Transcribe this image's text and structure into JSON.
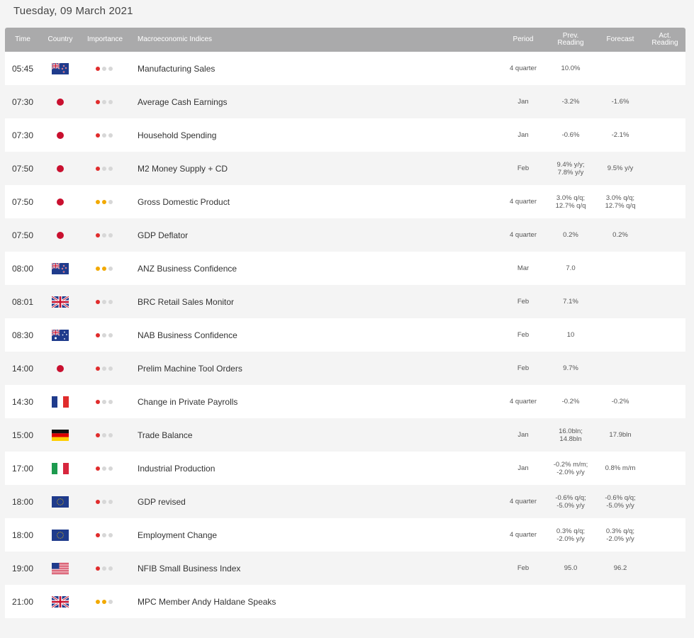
{
  "date": "Tuesday, 09 March 2021",
  "headers": {
    "time": "Time",
    "country": "Country",
    "importance": "Importance",
    "indices": "Macroeconomic Indices",
    "period": "Period",
    "prev_1": "Prev.",
    "prev_2": "Reading",
    "forecast": "Forecast",
    "act_1": "Act.",
    "act_2": "Reading"
  },
  "rows": [
    {
      "time": "05:45",
      "flag": "nz",
      "imp": 1,
      "name": "Manufacturing Sales",
      "period": "4 quarter",
      "prev": [
        "10.0%"
      ],
      "fcst": [],
      "act": []
    },
    {
      "time": "07:30",
      "flag": "jp",
      "imp": 1,
      "name": "Average Cash Earnings",
      "period": "Jan",
      "prev": [
        "-3.2%"
      ],
      "fcst": [
        "-1.6%"
      ],
      "act": []
    },
    {
      "time": "07:30",
      "flag": "jp",
      "imp": 1,
      "name": "Household Spending",
      "period": "Jan",
      "prev": [
        "-0.6%"
      ],
      "fcst": [
        "-2.1%"
      ],
      "act": []
    },
    {
      "time": "07:50",
      "flag": "jp",
      "imp": 1,
      "name": "M2 Money Supply + CD",
      "period": "Feb",
      "prev": [
        "9.4% y/y;",
        "7.8% y/y"
      ],
      "fcst": [
        "9.5% y/y"
      ],
      "act": []
    },
    {
      "time": "07:50",
      "flag": "jp",
      "imp": 2,
      "name": "Gross Domestic Product",
      "period": "4 quarter",
      "prev": [
        "3.0% q/q;",
        "12.7% q/q"
      ],
      "fcst": [
        "3.0% q/q;",
        "12.7% q/q"
      ],
      "act": []
    },
    {
      "time": "07:50",
      "flag": "jp",
      "imp": 1,
      "name": "GDP Deflator",
      "period": "4 quarter",
      "prev": [
        "0.2%"
      ],
      "fcst": [
        "0.2%"
      ],
      "act": []
    },
    {
      "time": "08:00",
      "flag": "nz",
      "imp": 2,
      "name": "ANZ Business Confidence",
      "period": "Mar",
      "prev": [
        "7.0"
      ],
      "fcst": [],
      "act": []
    },
    {
      "time": "08:01",
      "flag": "uk",
      "imp": 1,
      "name": "BRC Retail Sales Monitor",
      "period": "Feb",
      "prev": [
        "7.1%"
      ],
      "fcst": [],
      "act": []
    },
    {
      "time": "08:30",
      "flag": "au",
      "imp": 1,
      "name": "NAB Business Confidence",
      "period": "Feb",
      "prev": [
        "10"
      ],
      "fcst": [],
      "act": []
    },
    {
      "time": "14:00",
      "flag": "jp",
      "imp": 1,
      "name": "Prelim Machine Tool Orders",
      "period": "Feb",
      "prev": [
        "9.7%"
      ],
      "fcst": [],
      "act": []
    },
    {
      "time": "14:30",
      "flag": "fr",
      "imp": 1,
      "name": "Change in Private Payrolls",
      "period": "4 quarter",
      "prev": [
        "-0.2%"
      ],
      "fcst": [
        "-0.2%"
      ],
      "act": []
    },
    {
      "time": "15:00",
      "flag": "de",
      "imp": 1,
      "name": "Trade Balance",
      "period": "Jan",
      "prev": [
        "16.0bln;",
        "14.8bln"
      ],
      "fcst": [
        "17.9bln"
      ],
      "act": []
    },
    {
      "time": "17:00",
      "flag": "it",
      "imp": 1,
      "name": "Industrial Production",
      "period": "Jan",
      "prev": [
        "-0.2% m/m;",
        "-2.0% y/y"
      ],
      "fcst": [
        "0.8% m/m"
      ],
      "act": []
    },
    {
      "time": "18:00",
      "flag": "eu",
      "imp": 1,
      "name": "GDP revised",
      "period": "4 quarter",
      "prev": [
        "-0.6% q/q;",
        "-5.0% y/y"
      ],
      "fcst": [
        "-0.6% q/q;",
        "-5.0% y/y"
      ],
      "act": []
    },
    {
      "time": "18:00",
      "flag": "eu",
      "imp": 1,
      "name": "Employment Change",
      "period": "4 quarter",
      "prev": [
        "0.3% q/q;",
        "-2.0% y/y"
      ],
      "fcst": [
        "0.3% q/q;",
        "-2.0% y/y"
      ],
      "act": []
    },
    {
      "time": "19:00",
      "flag": "us",
      "imp": 1,
      "name": "NFIB Small Business Index",
      "period": "Feb",
      "prev": [
        "95.0"
      ],
      "fcst": [
        "96.2"
      ],
      "act": []
    },
    {
      "time": "21:00",
      "flag": "uk",
      "imp": 2,
      "name": "MPC Member Andy Haldane Speaks",
      "period": "",
      "prev": [],
      "fcst": [],
      "act": []
    }
  ],
  "colors": {
    "header_bg": "#aaaaab",
    "importance_high": "#e02c2c",
    "importance_medium": "#f2a900",
    "importance_off": "#d7d7d7"
  }
}
